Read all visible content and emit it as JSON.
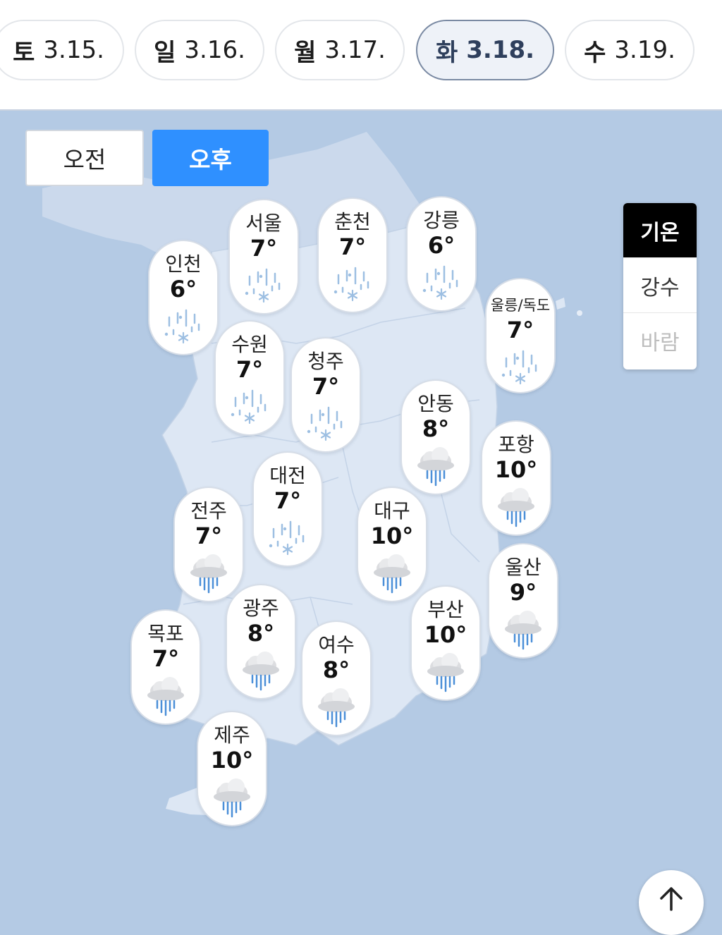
{
  "dates": [
    {
      "weekday": "토",
      "date": "3.15."
    },
    {
      "weekday": "일",
      "date": "3.16."
    },
    {
      "weekday": "월",
      "date": "3.17."
    },
    {
      "weekday": "화",
      "date": "3.18."
    },
    {
      "weekday": "수",
      "date": "3.19."
    }
  ],
  "selected_date_index": 3,
  "time_toggle": {
    "am": "오전",
    "pm": "오후",
    "selected": "pm"
  },
  "layers": {
    "temperature": "기온",
    "precipitation": "강수",
    "wind": "바람",
    "selected": "temperature"
  },
  "colors": {
    "accent": "#2f90ff",
    "map_sea": "#b4cae4",
    "map_land": "#dde7f4",
    "selected_layer": "#000000"
  },
  "cities": [
    {
      "name": "인천",
      "temp": "6°",
      "icon": "sleet-icon"
    },
    {
      "name": "서울",
      "temp": "7°",
      "icon": "sleet-icon"
    },
    {
      "name": "춘천",
      "temp": "7°",
      "icon": "sleet-icon"
    },
    {
      "name": "강릉",
      "temp": "6°",
      "icon": "sleet-icon"
    },
    {
      "name": "울릉/독도",
      "temp": "7°",
      "icon": "sleet-icon"
    },
    {
      "name": "수원",
      "temp": "7°",
      "icon": "sleet-icon"
    },
    {
      "name": "청주",
      "temp": "7°",
      "icon": "sleet-icon"
    },
    {
      "name": "안동",
      "temp": "8°",
      "icon": "rain-cloud-icon"
    },
    {
      "name": "포항",
      "temp": "10°",
      "icon": "rain-cloud-icon"
    },
    {
      "name": "대전",
      "temp": "7°",
      "icon": "sleet-icon"
    },
    {
      "name": "전주",
      "temp": "7°",
      "icon": "rain-cloud-icon"
    },
    {
      "name": "대구",
      "temp": "10°",
      "icon": "rain-cloud-icon"
    },
    {
      "name": "울산",
      "temp": "9°",
      "icon": "rain-cloud-icon"
    },
    {
      "name": "광주",
      "temp": "8°",
      "icon": "rain-cloud-icon"
    },
    {
      "name": "부산",
      "temp": "10°",
      "icon": "rain-cloud-icon"
    },
    {
      "name": "목포",
      "temp": "7°",
      "icon": "rain-cloud-icon"
    },
    {
      "name": "여수",
      "temp": "8°",
      "icon": "rain-cloud-icon"
    },
    {
      "name": "제주",
      "temp": "10°",
      "icon": "rain-cloud-icon"
    }
  ],
  "scroll_top_icon": "arrow-up-icon"
}
